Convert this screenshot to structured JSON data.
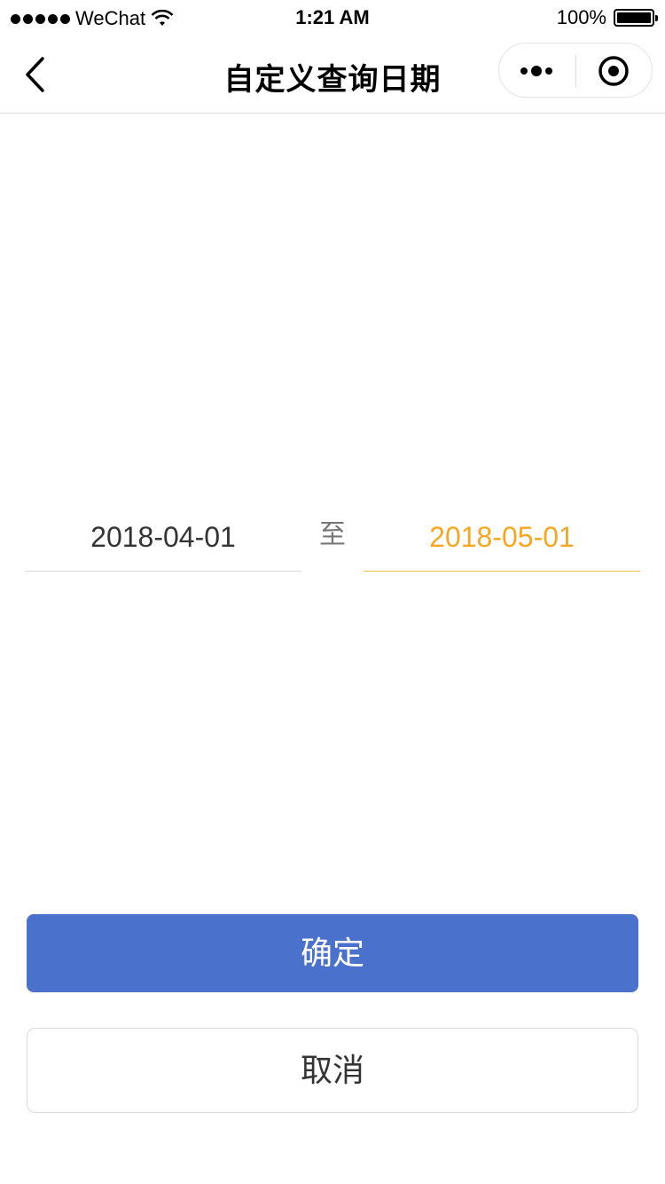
{
  "status_bar": {
    "carrier": "WeChat",
    "time": "1:21 AM",
    "battery": "100%",
    "battery_level": 1.0
  },
  "nav": {
    "title": "自定义查询日期"
  },
  "date_range": {
    "start": "2018-04-01",
    "separator": "至",
    "end": "2018-05-01",
    "active_color": "#f5a623"
  },
  "buttons": {
    "confirm": "确定",
    "cancel": "取消",
    "confirm_color": "#4a72cc"
  },
  "icons": {
    "back": "back-arrow-icon",
    "more": "more-dots-icon",
    "close": "target-circle-icon",
    "wifi": "wifi-icon",
    "battery": "battery-icon"
  }
}
